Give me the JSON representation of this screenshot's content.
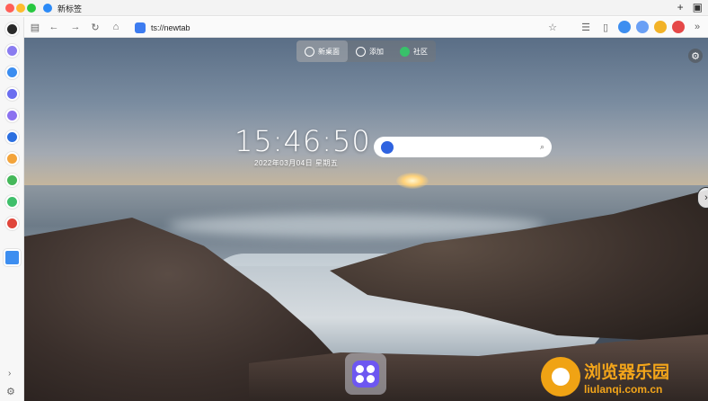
{
  "window": {
    "tab_title": "新标签",
    "titlebar_plus": "+",
    "titlebar_windows": "▣"
  },
  "toolbar": {
    "url": "ts://newtab",
    "back": "←",
    "forward": "→",
    "reload": "↻",
    "home": "⌂",
    "star": "☆",
    "more": "»"
  },
  "newtab": {
    "nav": [
      {
        "label": "新桌面",
        "icon": "pin-icon"
      },
      {
        "label": "添加",
        "icon": "plus-circle-icon"
      },
      {
        "label": "社区",
        "icon": "community-icon"
      }
    ],
    "settings_icon": "⚙",
    "clock": "15:46:50",
    "date": "2022年03月04日  星期五",
    "search_placeholder": "",
    "search_icon": "⌕",
    "next_arrow": "›"
  },
  "watermark": {
    "title": "浏览器乐园",
    "url": "liulanqi.com.cn"
  },
  "sidebar": {
    "collapse": "›",
    "settings": "⚙"
  },
  "colors": {
    "accent": "#2b8af7",
    "dock": "#6d57f1",
    "watermark": "#f3a51a"
  }
}
